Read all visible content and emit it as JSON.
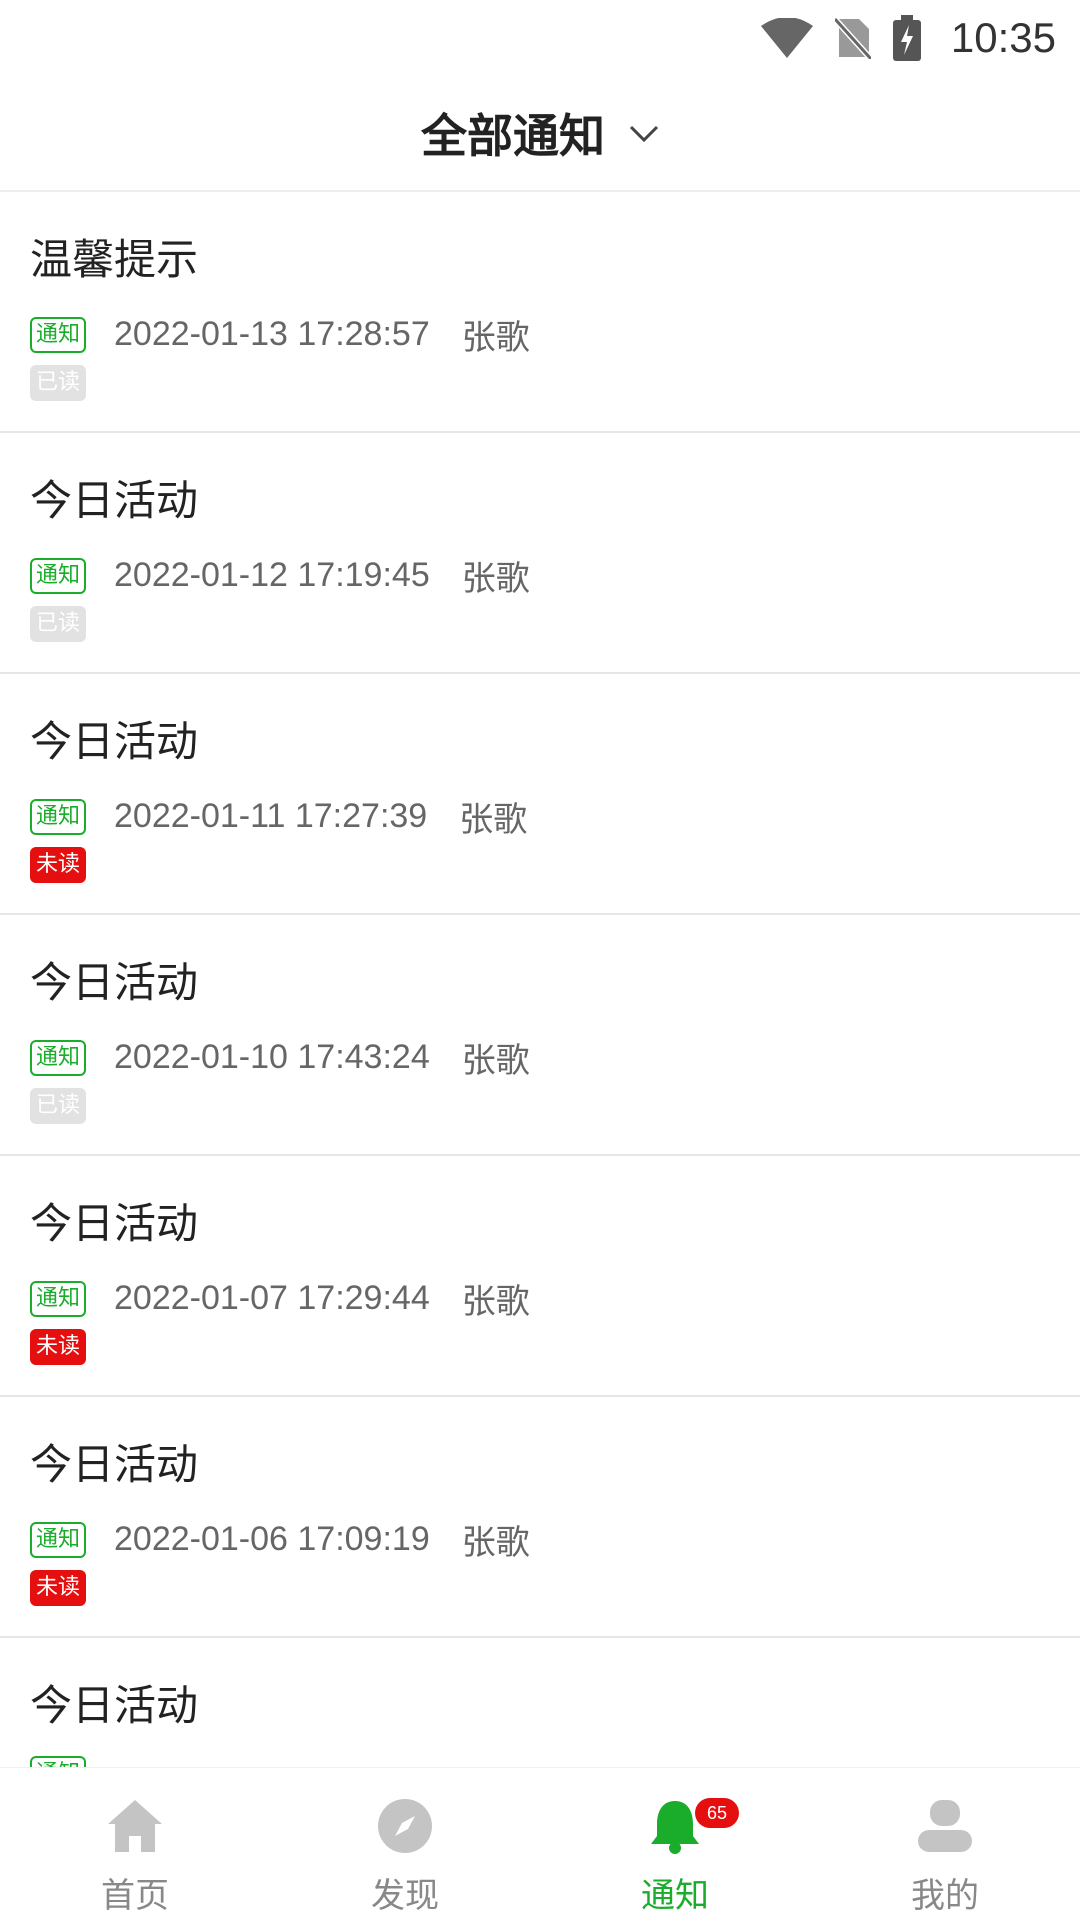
{
  "status_bar": {
    "time": "10:35"
  },
  "header": {
    "title": "全部通知"
  },
  "notifications": [
    {
      "title": "温馨提示",
      "type_tag": "通知",
      "datetime": "2022-01-13 17:28:57",
      "author": "张歌",
      "status": "已读"
    },
    {
      "title": "今日活动",
      "type_tag": "通知",
      "datetime": "2022-01-12 17:19:45",
      "author": "张歌",
      "status": "已读"
    },
    {
      "title": "今日活动",
      "type_tag": "通知",
      "datetime": "2022-01-11 17:27:39",
      "author": "张歌",
      "status": "未读"
    },
    {
      "title": "今日活动",
      "type_tag": "通知",
      "datetime": "2022-01-10 17:43:24",
      "author": "张歌",
      "status": "已读"
    },
    {
      "title": "今日活动",
      "type_tag": "通知",
      "datetime": "2022-01-07 17:29:44",
      "author": "张歌",
      "status": "未读"
    },
    {
      "title": "今日活动",
      "type_tag": "通知",
      "datetime": "2022-01-06 17:09:19",
      "author": "张歌",
      "status": "未读"
    },
    {
      "title": "今日活动",
      "type_tag": "通知",
      "datetime": "",
      "author": "",
      "status": ""
    }
  ],
  "bottom_nav": {
    "items": [
      {
        "label": "首页",
        "icon": "home-icon"
      },
      {
        "label": "发现",
        "icon": "compass-icon"
      },
      {
        "label": "通知",
        "icon": "bell-icon",
        "badge": "65",
        "active": true
      },
      {
        "label": "我的",
        "icon": "user-icon"
      }
    ]
  },
  "colors": {
    "accent": "#1aad2b",
    "unread": "#e60f0f",
    "read": "#e2e2e2"
  }
}
